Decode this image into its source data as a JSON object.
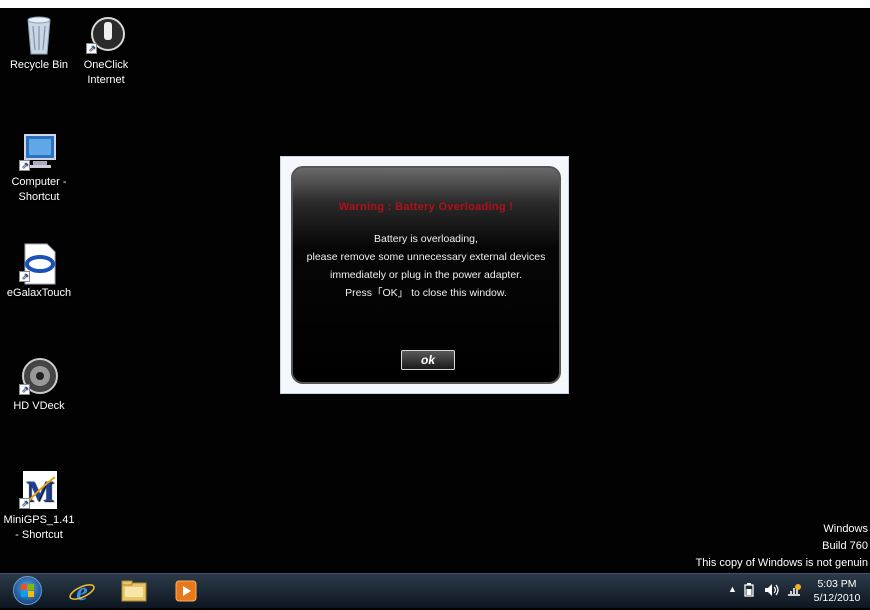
{
  "desktop_icons": [
    {
      "label": "Recycle Bin"
    },
    {
      "label_line1": "OneClick",
      "label_line2": "Internet"
    },
    {
      "label_line1": "Computer -",
      "label_line2": "Shortcut"
    },
    {
      "label": "eGalaxTouch"
    },
    {
      "label": "HD VDeck"
    },
    {
      "label_line1": "MiniGPS_1.41",
      "label_line2": "- Shortcut"
    }
  ],
  "dialog": {
    "title": "Warning : Battery Overloading !",
    "line1": "Battery is overloading,",
    "line2": "please remove some unnecessary external devices",
    "line3": "immediately or plug in the power adapter.",
    "line4": "Press「OK」 to close this window.",
    "ok_label": "ok"
  },
  "watermark": {
    "line1": "Windows",
    "line2": "Build 760",
    "line3": "This copy of Windows is not genuin"
  },
  "clock": {
    "time": "5:03 PM",
    "date": "5/12/2010"
  },
  "colors": {
    "warning_title": "#b0101a",
    "taskbar": "#1b2633"
  }
}
